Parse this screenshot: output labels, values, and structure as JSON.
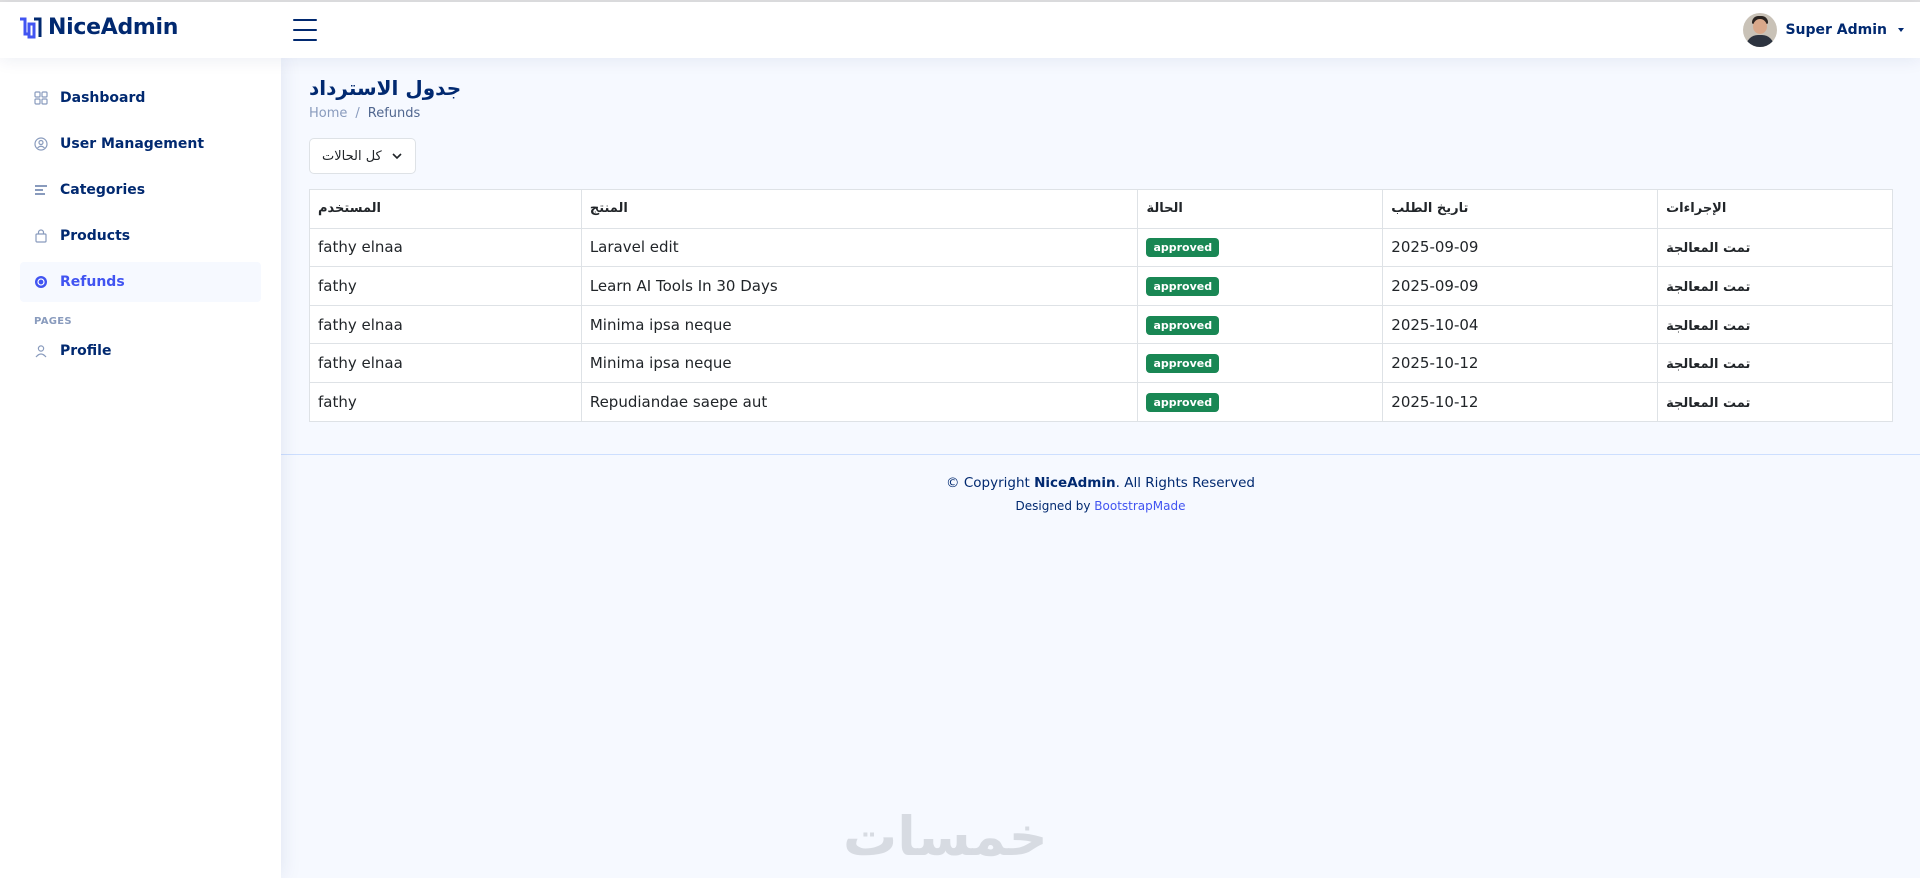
{
  "app": {
    "name": "NiceAdmin"
  },
  "header": {
    "user_name": "Super Admin"
  },
  "sidebar": {
    "items": [
      {
        "label": "Dashboard",
        "icon": "grid-icon"
      },
      {
        "label": "User Management",
        "icon": "user-circle-icon"
      },
      {
        "label": "Categories",
        "icon": "list-icon"
      },
      {
        "label": "Products",
        "icon": "bag-icon"
      },
      {
        "label": "Refunds",
        "icon": "coin-icon",
        "active": true
      }
    ],
    "heading": "PAGES",
    "pages": [
      {
        "label": "Profile",
        "icon": "person-icon"
      }
    ]
  },
  "page": {
    "title": "جدول الاسترداد",
    "breadcrumb": {
      "home": "Home",
      "current": "Refunds"
    }
  },
  "filter": {
    "selected": "كل الحالات"
  },
  "table": {
    "headers": [
      "المستخدم",
      "المنتج",
      "الحالة",
      "تاريخ الطلب",
      "الإجراءات"
    ],
    "rows": [
      {
        "user": "fathy elnaa",
        "product": "Laravel edit",
        "status": "approved",
        "date": "2025-09-09",
        "action": "تمت المعالجة"
      },
      {
        "user": "fathy",
        "product": "Learn AI Tools In 30 Days",
        "status": "approved",
        "date": "2025-09-09",
        "action": "تمت المعالجة"
      },
      {
        "user": "fathy elnaa",
        "product": "Minima ipsa neque",
        "status": "approved",
        "date": "2025-10-04",
        "action": "تمت المعالجة"
      },
      {
        "user": "fathy elnaa",
        "product": "Minima ipsa neque",
        "status": "approved",
        "date": "2025-10-12",
        "action": "تمت المعالجة"
      },
      {
        "user": "fathy",
        "product": "Repudiandae saepe aut",
        "status": "approved",
        "date": "2025-10-12",
        "action": "تمت المعالجة"
      }
    ]
  },
  "footer": {
    "copyright_prefix": "© Copyright",
    "brand": "NiceAdmin",
    "rights": ". All Rights Reserved",
    "designed_by": "Designed by",
    "designer": "BootstrapMade"
  },
  "watermark": "خمسات",
  "colors": {
    "primary": "#012970",
    "accent": "#4154f1",
    "success": "#198754",
    "background": "#f6f9ff"
  }
}
